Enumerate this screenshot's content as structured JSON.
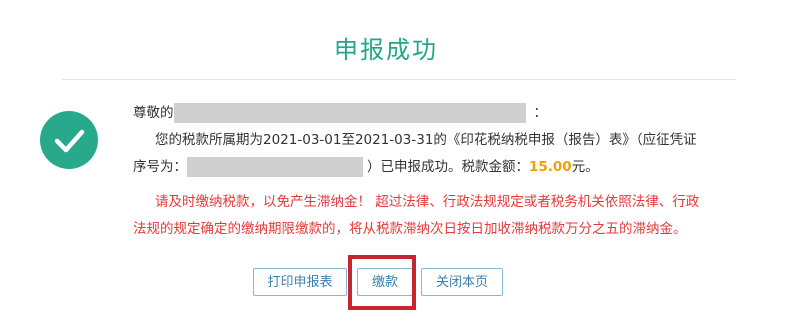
{
  "header": {
    "title": "申报成功"
  },
  "icons": {
    "success": "check-circle-icon"
  },
  "message": {
    "greeting_prefix": "尊敬的",
    "greeting_suffix": "：",
    "line1": "您的税款所属期为2021-03-01至2021-03-31的《印花税纳税申报（报告）表》（应征凭证",
    "line2_prefix": "序号为：",
    "line2_suffix": "）已申报成功。税款金额：",
    "amount": "15.00",
    "amount_unit": "元。",
    "warning_line1": "请及时缴纳税款，以免产生滞纳金！ 超过法律、行政法规规定或者税务机关依照法律、行政",
    "warning_line2": "法规的规定确定的缴纳期限缴款的，将从税款滞纳次日按日加收滞纳税款万分之五的滞纳金。"
  },
  "buttons": {
    "print": "打印申报表",
    "pay": "缴款",
    "close": "关闭本页"
  },
  "colors": {
    "accent": "#22a78a",
    "check_bg": "#29a98c",
    "warning": "#e53a3a",
    "amount": "#f0a202",
    "button_border": "#86b7d6",
    "highlight": "#c8262c"
  }
}
